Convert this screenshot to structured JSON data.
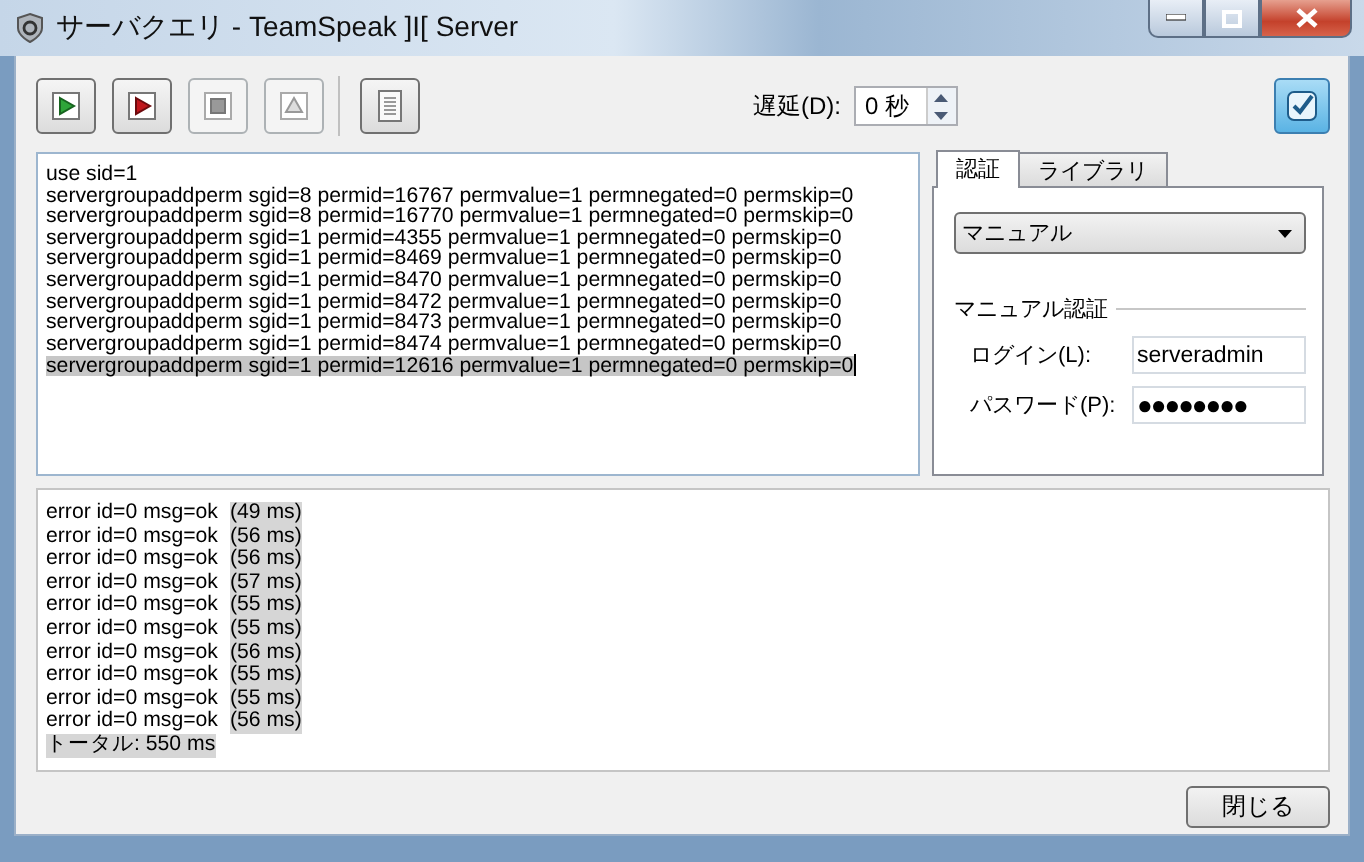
{
  "window": {
    "title": "サーバクエリ - TeamSpeak ]I[ Server"
  },
  "toolbar": {
    "buttons": [
      {
        "kind": "run",
        "disabled": false
      },
      {
        "kind": "run-stop",
        "disabled": false
      },
      {
        "kind": "stop",
        "disabled": true
      },
      {
        "kind": "eject",
        "disabled": true
      },
      {
        "kind": "document",
        "disabled": false
      }
    ],
    "delay_label": "遅延(D):",
    "delay_value": "0 秒"
  },
  "editor": {
    "lines": [
      {
        "text": "use sid=1",
        "selected": false
      },
      {
        "text": "servergroupaddperm sgid=8 permid=16767 permvalue=1 permnegated=0 permskip=0",
        "selected": false
      },
      {
        "text": "servergroupaddperm sgid=8 permid=16770 permvalue=1 permnegated=0 permskip=0",
        "selected": false
      },
      {
        "text": "servergroupaddperm sgid=1 permid=4355 permvalue=1 permnegated=0 permskip=0",
        "selected": false
      },
      {
        "text": "servergroupaddperm sgid=1 permid=8469 permvalue=1 permnegated=0 permskip=0",
        "selected": false
      },
      {
        "text": "servergroupaddperm sgid=1 permid=8470 permvalue=1 permnegated=0 permskip=0",
        "selected": false
      },
      {
        "text": "servergroupaddperm sgid=1 permid=8472 permvalue=1 permnegated=0 permskip=0",
        "selected": false
      },
      {
        "text": "servergroupaddperm sgid=1 permid=8473 permvalue=1 permnegated=0 permskip=0",
        "selected": false
      },
      {
        "text": "servergroupaddperm sgid=1 permid=8474 permvalue=1 permnegated=0 permskip=0",
        "selected": false
      },
      {
        "text": "servergroupaddperm sgid=1 permid=12616 permvalue=1 permnegated=0 permskip=0",
        "selected": true
      }
    ]
  },
  "side": {
    "tabs": [
      {
        "label": "認証",
        "selected": true
      },
      {
        "label": "ライブラリ",
        "selected": false
      }
    ],
    "mode": "マニュアル",
    "group": "マニュアル認証",
    "login_label": "ログイン(L):",
    "login": "serveradmin",
    "password_label": "パスワード(P):",
    "password": "●●●●●●●●"
  },
  "output": {
    "lines": [
      {
        "result": "error id=0 msg=ok",
        "time": "(49 ms)"
      },
      {
        "result": "error id=0 msg=ok",
        "time": "(56 ms)"
      },
      {
        "result": "error id=0 msg=ok",
        "time": "(56 ms)"
      },
      {
        "result": "error id=0 msg=ok",
        "time": "(57 ms)"
      },
      {
        "result": "error id=0 msg=ok",
        "time": "(55 ms)"
      },
      {
        "result": "error id=0 msg=ok",
        "time": "(55 ms)"
      },
      {
        "result": "error id=0 msg=ok",
        "time": "(56 ms)"
      },
      {
        "result": "error id=0 msg=ok",
        "time": "(55 ms)"
      },
      {
        "result": "error id=0 msg=ok",
        "time": "(55 ms)"
      },
      {
        "result": "error id=0 msg=ok",
        "time": "(56 ms)"
      }
    ],
    "total": "トータル: 550 ms"
  },
  "close_button": "閉じる"
}
